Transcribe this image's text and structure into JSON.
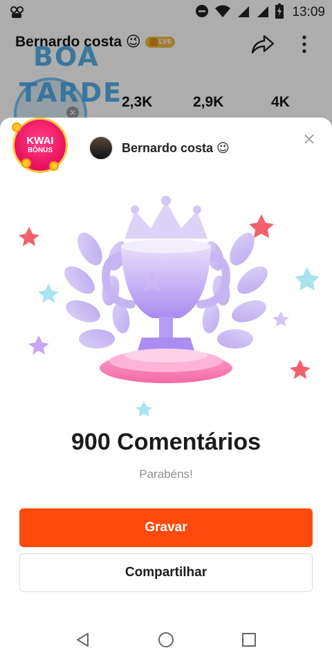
{
  "status_bar": {
    "time": "13:09"
  },
  "profile": {
    "name": "Bernardo costa 😉",
    "level": "LV6",
    "overlay_line1": "BOA",
    "overlay_line2": "TARDE",
    "stats": [
      "2,3K",
      "2,9K",
      "4K"
    ]
  },
  "sheet": {
    "badge_line1": "KWAI",
    "badge_line2": "BÔNUS",
    "username": "Bernardo costa 😉",
    "title": "900 Comentários",
    "subtitle": "Parabéns!",
    "primary_button": "Gravar",
    "secondary_button": "Compartilhar"
  },
  "icons": {
    "share": "share-arrow-icon",
    "more": "more-vertical-icon",
    "close": "close-icon",
    "trophy": "trophy-icon",
    "nav_back": "back-triangle-icon",
    "nav_home": "home-circle-icon",
    "nav_recent": "recent-square-icon"
  },
  "colors": {
    "primary": "#fe4a0c",
    "badge": "#e8105b",
    "overlay_text": "#46a7e6"
  }
}
